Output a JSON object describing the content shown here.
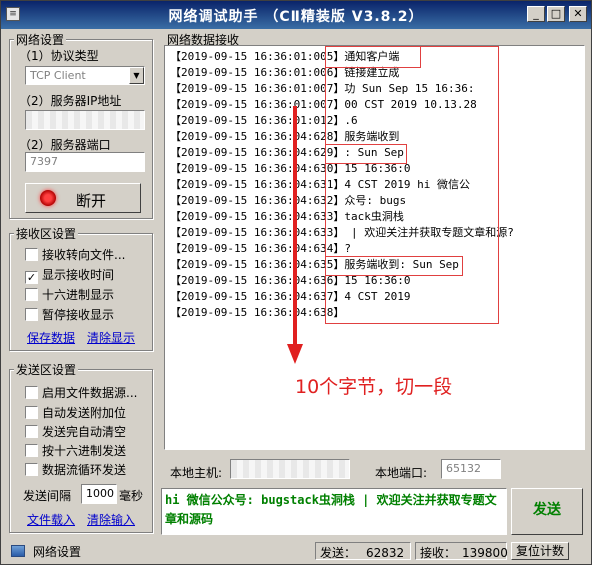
{
  "window": {
    "title": "网络调试助手 （C​Ⅱ精装版 V3.8.2）",
    "minimize": "_",
    "maximize": "□",
    "close": "✕",
    "icon_text": "≡"
  },
  "net_settings": {
    "title": "网络设置",
    "protocol_label": "（1）协议类型",
    "protocol_value": "TCP Client",
    "server_ip_label": "（2）服务器IP地址",
    "server_port_label": "（2）服务器端口",
    "server_port_value": "7397",
    "disconnect_button": "断开"
  },
  "recv_settings": {
    "title": "接收区设置",
    "options": [
      {
        "label": "接收转向文件...",
        "checked": ""
      },
      {
        "label": "显示接收时间",
        "checked": "✓"
      },
      {
        "label": "十六进制显示",
        "checked": ""
      },
      {
        "label": "暂停接收显示",
        "checked": ""
      }
    ],
    "save_link": "保存数据",
    "clear_link": "清除显示"
  },
  "send_settings": {
    "title": "发送区设置",
    "options": [
      {
        "label": "启用文件数据源...",
        "checked": ""
      },
      {
        "label": "自动发送附加位",
        "checked": ""
      },
      {
        "label": "发送完自动清空",
        "checked": ""
      },
      {
        "label": "按十六进制发送",
        "checked": ""
      },
      {
        "label": "数据流循环发送",
        "checked": ""
      }
    ],
    "interval_label": "发送间隔",
    "interval_value": "1000",
    "interval_unit": "毫秒",
    "load_file_link": "文件载入",
    "clear_input_link": "清除输入"
  },
  "recv_area": {
    "title": "网络数据接收",
    "lines": [
      {
        "time": "【2019-09-15 16:36:01:005】",
        "text": "通知客户端"
      },
      {
        "time": "【2019-09-15 16:36:01:006】",
        "text": "链接建立成"
      },
      {
        "time": "【2019-09-15 16:36:01:007】",
        "text": "功 Sun Sep 15 16:36:"
      },
      {
        "time": "【2019-09-15 16:36:01:007】",
        "text": "00 CST 2019 10.13.28"
      },
      {
        "time": "【2019-09-15 16:36:01:012】",
        "text": ".6"
      },
      {
        "time": "【2019-09-15 16:36:04:628】",
        "text": "服务端收到"
      },
      {
        "time": "【2019-09-15 16:36:04:629】",
        "text": ": Sun Sep"
      },
      {
        "time": "【2019-09-15 16:36:04:630】",
        "text": "15 16:36:0"
      },
      {
        "time": "【2019-09-15 16:36:04:631】",
        "text": "4 CST 2019 hi 微信公"
      },
      {
        "time": "【2019-09-15 16:36:04:632】",
        "text": "众号: bugs"
      },
      {
        "time": "【2019-09-15 16:36:04:633】",
        "text": "tack虫洞栈"
      },
      {
        "time": "【2019-09-15 16:36:04:633】",
        "text": " | 欢迎关注并获取专题文章和源?"
      },
      {
        "time": "【2019-09-15 16:36:04:634】",
        "text": "?"
      },
      {
        "time": "【2019-09-15 16:36:04:635】",
        "text": "服务端收到: Sun Sep"
      },
      {
        "time": "【2019-09-15 16:36:04:636】",
        "text": "15 16:36:0"
      },
      {
        "time": "【2019-09-15 16:36:04:637】",
        "text": "4 CST 2019"
      },
      {
        "time": "【2019-09-15 16:36:04:638】",
        "text": ""
      }
    ],
    "annotation": "10个字节，切一段"
  },
  "host_bar": {
    "local_host_label": "本地主机:",
    "local_port_label": "本地端口:",
    "local_port_value": "65132"
  },
  "send_area": {
    "text": "hi 微信公众号: bugstack虫洞栈 | 欢迎关注并获取专题文章和源码",
    "send_button": "发送"
  },
  "status_bar": {
    "label": "网络设置",
    "sent_label": "发送：",
    "sent_value": "62832",
    "recv_label": "接收：",
    "recv_value": "139800",
    "reset_button": "复位计数"
  },
  "colors": {
    "annotation": "#e02020",
    "send_text": "#008000",
    "title_start": "#0a246a",
    "title_end": "#3a6ea5"
  }
}
